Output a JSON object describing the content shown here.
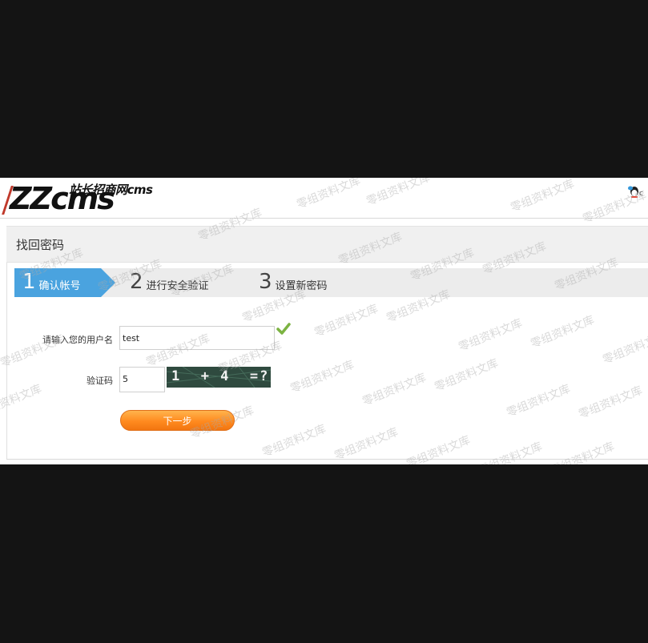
{
  "logo": {
    "main": "ZZcms",
    "sub": "站长招商网cms"
  },
  "page_title": "找回密码",
  "steps": [
    {
      "num": "1",
      "label": "确认帐号"
    },
    {
      "num": "2",
      "label": "进行安全验证"
    },
    {
      "num": "3",
      "label": "设置新密码"
    }
  ],
  "form": {
    "username_label": "请输入您的用户名",
    "username_value": "test",
    "captcha_label": "验证码",
    "captcha_value": "5",
    "captcha_image_text": "1  + 4  =?"
  },
  "next_button": "下一步",
  "watermark": "零组资料文库",
  "colors": {
    "active_step": "#4aa3df",
    "button": "#ff8a1f",
    "check": "#7cb342"
  }
}
